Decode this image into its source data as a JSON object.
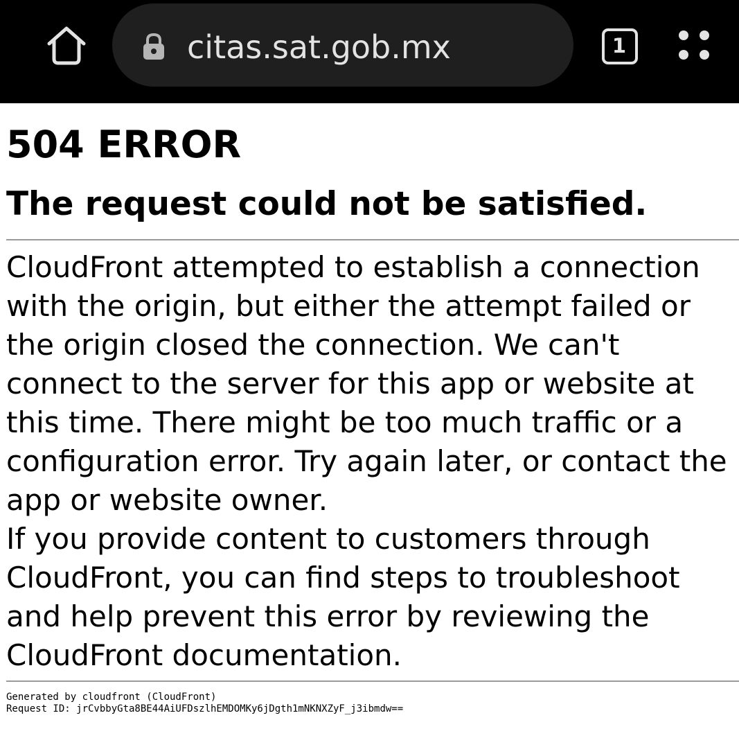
{
  "browser": {
    "url": "citas.sat.gob.mx",
    "tab_count": "1",
    "icons": {
      "home": "home-icon",
      "lock": "lock-icon",
      "tabs": "tabs-icon",
      "menu": "menu-dots-icon"
    },
    "toolbar_color": "#000000",
    "url_bar_color": "#1f1f1f"
  },
  "page": {
    "title": "504 ERROR",
    "subtitle": "The request could not be satisfied.",
    "paragraph_1": "CloudFront attempted to establish a connection with the origin, but either the attempt failed or the origin closed the connection. We can't connect to the server for this app or website at this time. There might be too much traffic or a configuration error. Try again later, or contact the app or website owner.",
    "paragraph_2": "If you provide content to customers through CloudFront, you can find steps to troubleshoot and help prevent this error by reviewing the CloudFront documentation.",
    "footer_generated": "Generated by cloudfront (CloudFront)",
    "footer_request_id": "Request ID: jrCvbbyGta8BE44AiUFDszlhEMDOMKy6jDgth1mNKNXZyF_j3ibmdw=="
  }
}
